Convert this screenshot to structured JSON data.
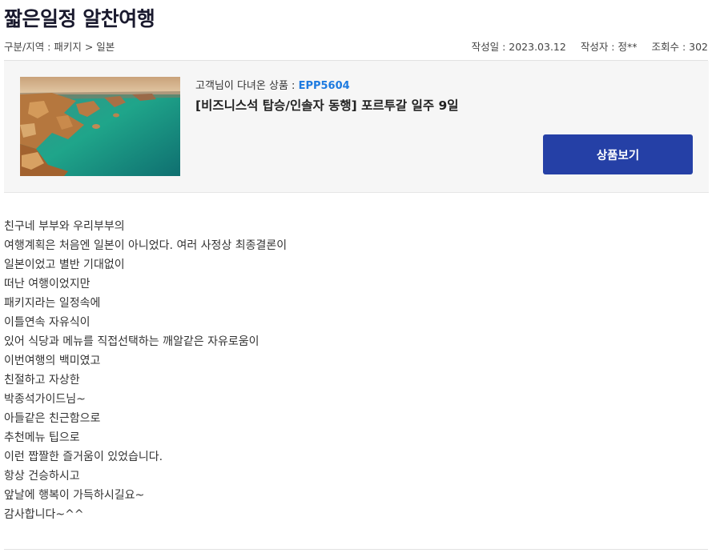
{
  "post": {
    "title": "짧은일정 알찬여행",
    "category_label": "구분/지역 : 패키지 > 일본",
    "date_label": "작성일 : 2023.03.12",
    "author_label": "작성자 : 정**",
    "views_label": "조회수 : 302"
  },
  "product": {
    "prefix": "고객님이 다녀온 상품 : ",
    "code": "EPP5604",
    "name": "[비즈니스석 탑승/인솔자 동행] 포르투갈 일주 9일",
    "button_label": "상품보기",
    "image_icon": "coastal-landscape-photo"
  },
  "body_lines": [
    "친구네 부부와 우리부부의",
    "여행계획은 처음엔 일본이 아니었다. 여러 사정상 최종결론이",
    "일본이었고 별반 기대없이",
    "떠난 여행이었지만",
    "패키지라는 일정속에",
    "이틀연속 자유식이",
    "있어 식당과 메뉴를 직접선택하는 깨알같은 자유로움이",
    "이번여행의 백미였고",
    "친절하고 자상한",
    "박종석가이드님~",
    "아들같은 친근함으로",
    "추천메뉴 팁으로",
    "이런 짭짤한 즐거움이 있었습니다.",
    "항상 건승하시고",
    "앞날에 행복이 가득하시길요~",
    "감사합니다~^^"
  ],
  "colors": {
    "accent": "#2540a6",
    "code": "#1e7be0",
    "panel": "#f6f6f6"
  }
}
